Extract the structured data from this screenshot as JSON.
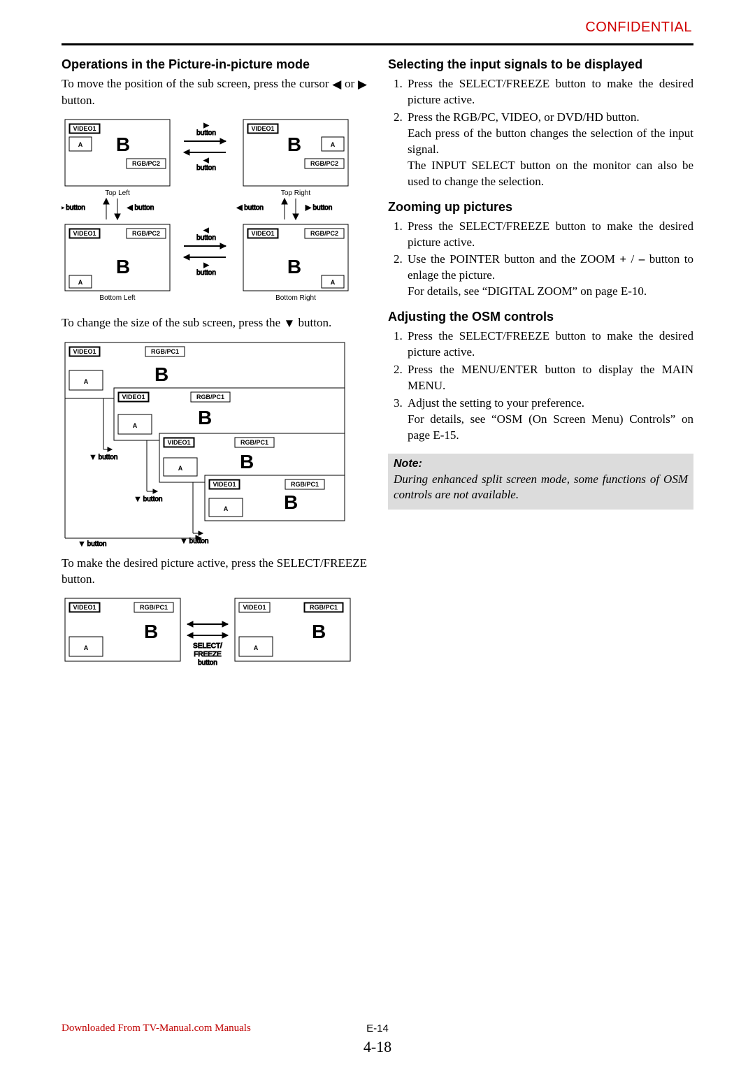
{
  "confidential": "CONFIDENTIAL",
  "left": {
    "h1": "Operations in the Picture-in-picture mode",
    "p1a": "To move the position of the sub screen, press the cursor ",
    "p1b": " or ",
    "p1c": " button.",
    "diag1": {
      "video1": "VIDEO1",
      "rgbpc2": "RGB/PC2",
      "rgbpc1": "RGB/PC1",
      "a": "A",
      "b": "B",
      "tl": "Top Left",
      "tr": "Top Right",
      "bl": "Bottom Left",
      "br": "Bottom Right",
      "button": "button",
      "select": "SELECT/\nFREEZE\nbutton"
    },
    "p2a": "To change the size of the sub screen, press the ",
    "p2b": " button.",
    "p3": "To make the desired picture active, press the SELECT/FREEZE button."
  },
  "right": {
    "h1": "Selecting the input signals to be displayed",
    "s1": {
      "n1": "1.",
      "t1": "Press the SELECT/FREEZE button to make the desired picture active.",
      "n2": "2.",
      "t2": "Press the RGB/PC, VIDEO, or DVD/HD button.\nEach press of the button changes the selection of the input signal.\nThe INPUT SELECT button on the monitor can also be used to change the selection."
    },
    "h2": "Zooming up pictures",
    "s2": {
      "n1": "1.",
      "t1": "Press the SELECT/FREEZE button to make the desired picture active.",
      "n2": "2.",
      "t2a": "Use the POINTER button and the ZOOM ",
      "plus": "+",
      "slash": " / ",
      "minus": "–",
      "t2b": " button to enlage the picture.\nFor details, see “DIGITAL ZOOM” on page E-10."
    },
    "h3": "Adjusting the OSM controls",
    "s3": {
      "n1": "1.",
      "t1": "Press the SELECT/FREEZE button to make the desired picture active.",
      "n2": "2.",
      "t2": "Press the MENU/ENTER button to display the MAIN MENU.",
      "n3": "3.",
      "t3": "Adjust the setting to your preference.\nFor details, see “OSM (On Screen Menu) Controls” on page E-15."
    },
    "note_title": "Note:",
    "note_body": "During enhanced split screen mode, some functions of OSM controls are not available."
  },
  "footer": {
    "dl": "Downloaded From TV-Manual.com Manuals",
    "pg1": "E-14",
    "pg2": "4-18"
  }
}
